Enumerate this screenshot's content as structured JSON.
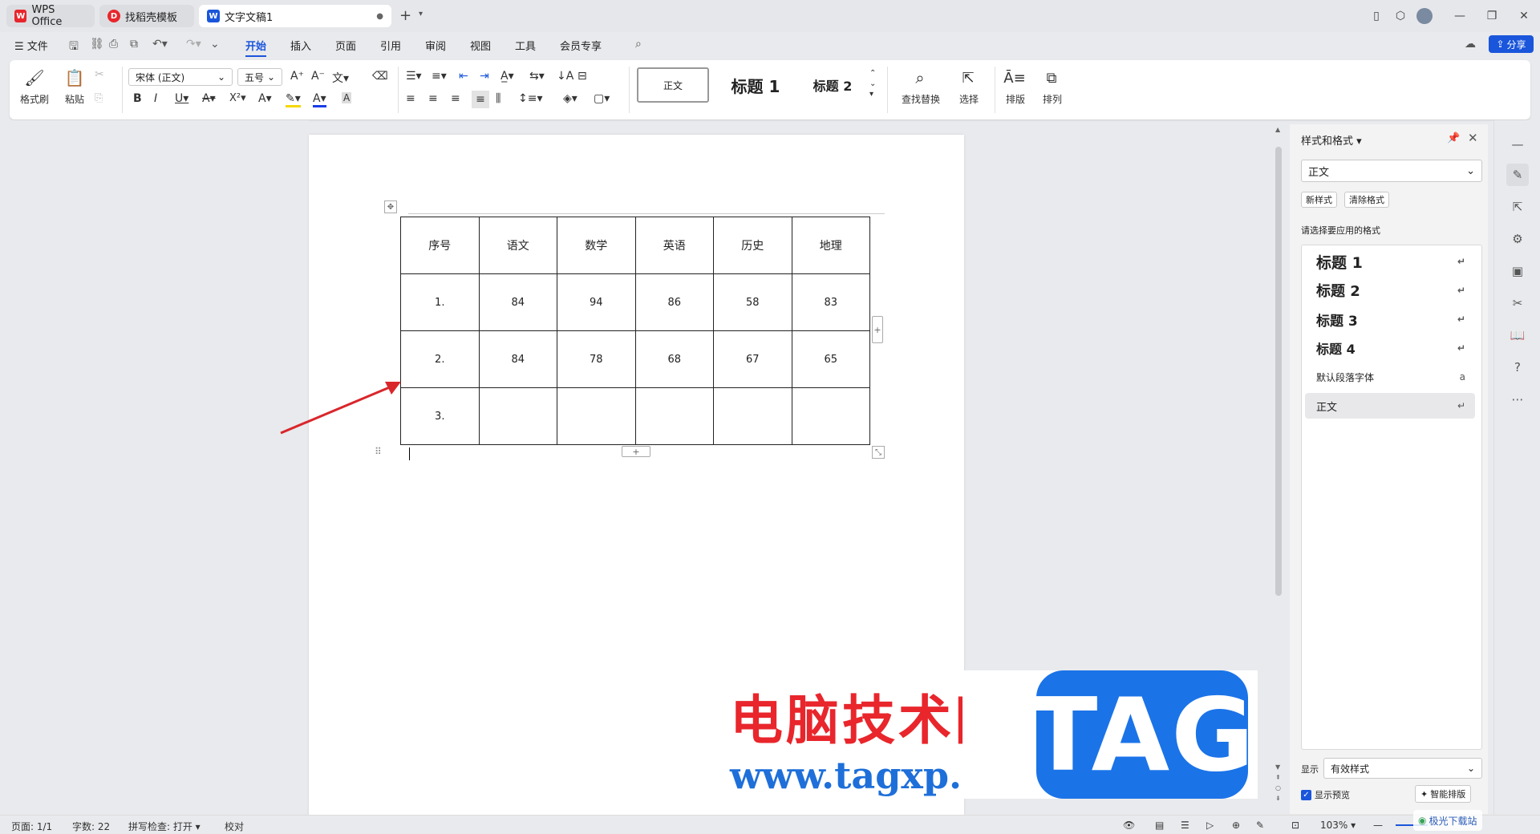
{
  "tabs": [
    {
      "label": "WPS Office",
      "icon": "wps-logo-icon"
    },
    {
      "label": "找稻壳模板",
      "icon": "docer-icon"
    },
    {
      "label": "文字文稿1",
      "icon": "writer-doc-icon"
    }
  ],
  "menu": {
    "file": "文件",
    "items": [
      "开始",
      "插入",
      "页面",
      "引用",
      "审阅",
      "视图",
      "工具",
      "会员专享"
    ],
    "active": "开始",
    "share": "分享"
  },
  "ribbon": {
    "format_painter": "格式刷",
    "paste": "粘贴",
    "font_name": "宋体 (正文)",
    "font_size": "五号",
    "styles": [
      "正文",
      "标题 1",
      "标题 2"
    ],
    "find_replace": "查找替换",
    "select": "选择",
    "layout": "排版",
    "arrange": "排列"
  },
  "table": {
    "headers": [
      "序号",
      "语文",
      "数学",
      "英语",
      "历史",
      "地理"
    ],
    "rows": [
      [
        "1.",
        "84",
        "94",
        "86",
        "58",
        "83"
      ],
      [
        "2.",
        "84",
        "78",
        "68",
        "67",
        "65"
      ],
      [
        "3.",
        "",
        "",
        "",
        "",
        ""
      ]
    ]
  },
  "style_panel": {
    "title": "样式和格式",
    "current_style": "正文",
    "new_style": "新样式",
    "clear_format": "清除格式",
    "prompt": "请选择要应用的格式",
    "styles": [
      "标题 1",
      "标题 2",
      "标题 3",
      "标题 4",
      "默认段落字体",
      "正文"
    ],
    "selected": "正文",
    "show_label": "显示",
    "show_value": "有效样式",
    "preview_label": "显示预览",
    "smart_layout": "智能排版"
  },
  "status": {
    "page": "页面: 1/1",
    "words": "字数: 22",
    "spellcheck": "拼写检查: 打开",
    "proof": "校对",
    "zoom": "103%"
  },
  "watermark": {
    "site_name": "电脑技术网",
    "url": "www.tagxp.com",
    "tag": "TAG",
    "corner": "极光下载站"
  },
  "colors": {
    "accent": "#1a56db",
    "wps_red": "#e8262c",
    "tag_blue": "#1b73e8",
    "arrow": "#d9262b"
  }
}
